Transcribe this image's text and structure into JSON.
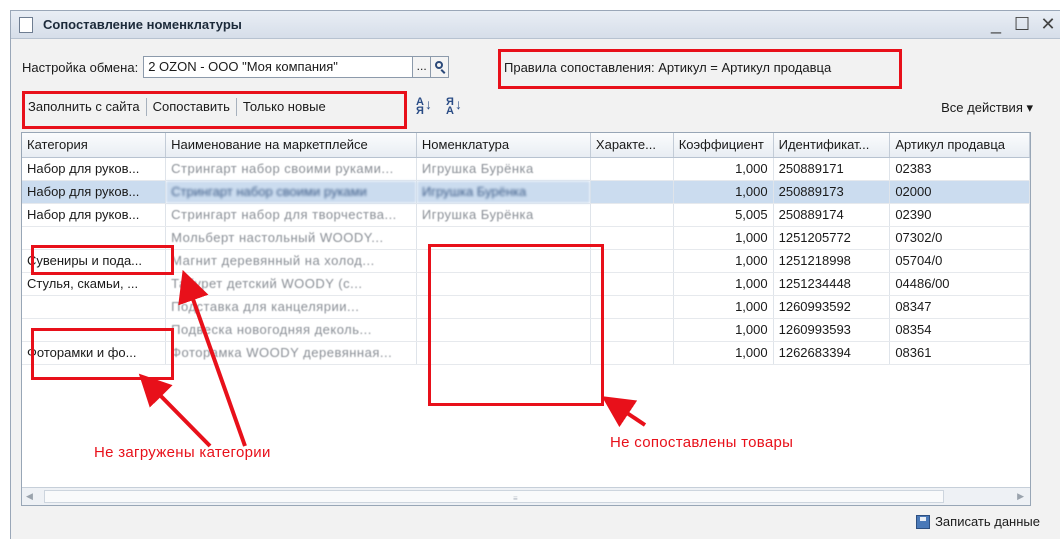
{
  "window": {
    "title": "Сопоставление номенклатуры",
    "controls": [
      "_",
      "☐",
      "✕"
    ]
  },
  "settings": {
    "exchange_label": "Настройка обмена:",
    "exchange_value": "2 OZON - ООО \"Моя компания\"",
    "dots_label": "...",
    "rules_text": "Правила сопоставления: Артикул = Артикул продавца"
  },
  "toolbar": {
    "fill_from_site": "Заполнить с сайта",
    "match": "Сопоставить",
    "only_new": "Только новые",
    "sort_asc_icon": "sort-ascending-icon",
    "sort_desc_icon": "sort-descending-icon",
    "all_actions": "Все действия ▾"
  },
  "grid": {
    "columns": [
      "Категория",
      "Наименование на маркетплейсе",
      "Номенклатура",
      "Характе...",
      "Коэффициент",
      "Идентификат...",
      "Артикул продавца"
    ],
    "rows": [
      {
        "category": "Набор для руков...",
        "name": "Стрингарт набор своими руками...",
        "nomenclature": "Игрушка Бурёнка",
        "characteristic": "",
        "coefficient": "1,000",
        "identifier": "250889171",
        "article": "02383",
        "selected": false
      },
      {
        "category": "Набор для руков...",
        "name": "Стрингарт набор своими руками",
        "nomenclature": "Игрушка Бурёнка",
        "characteristic": "",
        "coefficient": "1,000",
        "identifier": "250889173",
        "article": "02000",
        "selected": true
      },
      {
        "category": "Набор для руков...",
        "name": "Стрингарт набор для творчества...",
        "nomenclature": "Игрушка Бурёнка",
        "characteristic": "",
        "coefficient": "5,005",
        "identifier": "250889174",
        "article": "02390",
        "selected": false
      },
      {
        "category": "",
        "name": "Мольберт настольный WOODY...",
        "nomenclature": "",
        "characteristic": "",
        "coefficient": "1,000",
        "identifier": "1251205772",
        "article": "07302/0",
        "selected": false
      },
      {
        "category": "Сувениры и пода...",
        "name": "Магнит деревянный на холод...",
        "nomenclature": "",
        "characteristic": "",
        "coefficient": "1,000",
        "identifier": "1251218998",
        "article": "05704/0",
        "selected": false
      },
      {
        "category": "Стулья, скамьи, ...",
        "name": "Табурет детский WOODY (с...",
        "nomenclature": "",
        "characteristic": "",
        "coefficient": "1,000",
        "identifier": "1251234448",
        "article": "04486/00",
        "selected": false
      },
      {
        "category": "",
        "name": "Подставка для канцелярии...",
        "nomenclature": "",
        "characteristic": "",
        "coefficient": "1,000",
        "identifier": "1260993592",
        "article": "08347",
        "selected": false
      },
      {
        "category": "",
        "name": "Подвеска новогодняя деколь...",
        "nomenclature": "",
        "characteristic": "",
        "coefficient": "1,000",
        "identifier": "1260993593",
        "article": "08354",
        "selected": false
      },
      {
        "category": "Фоторамки и фо...",
        "name": "Фоторамка WOODY деревянная...",
        "nomenclature": "",
        "characteristic": "",
        "coefficient": "1,000",
        "identifier": "1262683394",
        "article": "08361",
        "selected": false
      }
    ]
  },
  "footer": {
    "save_label": "Записать данные"
  },
  "annotations": {
    "categories_not_loaded": "Не загружены категории",
    "goods_not_matched": "Не сопоставлены товары",
    "highlight_color": "#e8101a"
  }
}
